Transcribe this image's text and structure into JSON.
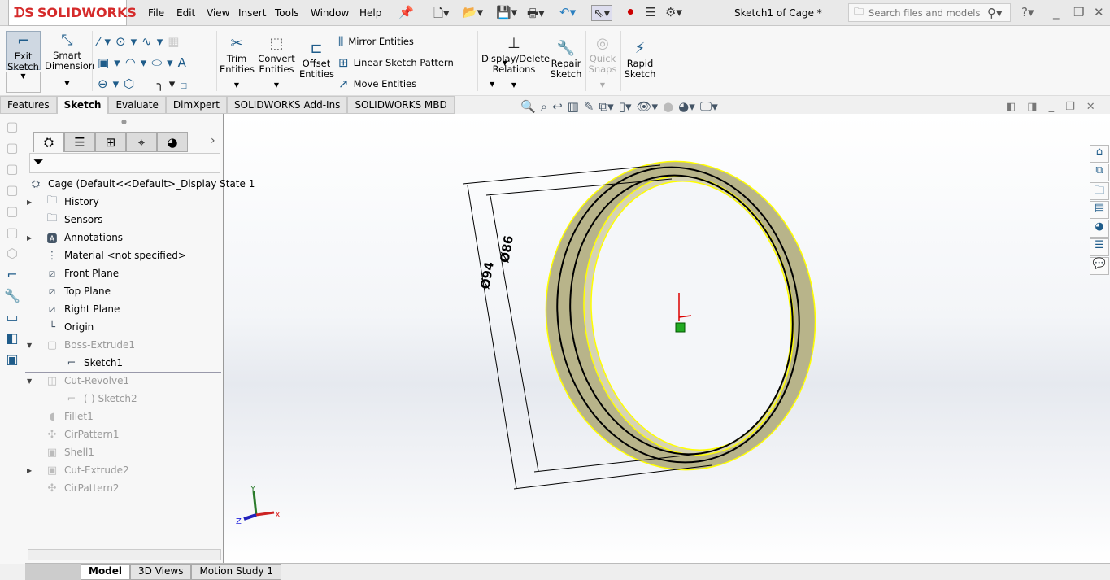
{
  "app": {
    "logo": "SOLIDWORKS",
    "document_title": "Sketch1 of Cage *"
  },
  "menu": [
    "File",
    "Edit",
    "View",
    "Insert",
    "Tools",
    "Window",
    "Help"
  ],
  "search": {
    "placeholder": "Search files and models"
  },
  "ribbon": {
    "exit_sketch": "Exit Sketch",
    "smart_dimension": "Smart Dimension",
    "trim": "Trim Entities",
    "convert": "Convert Entities",
    "offset": "Offset Entities",
    "mirror": "Mirror Entities",
    "linear_pattern": "Linear Sketch Pattern",
    "move": "Move Entities",
    "relations": "Display/Delete Relations",
    "repair": "Repair Sketch",
    "quick_snaps": "Quick Snaps",
    "rapid": "Rapid Sketch"
  },
  "tabs": [
    "Features",
    "Sketch",
    "Evaluate",
    "DimXpert",
    "SOLIDWORKS Add-Ins",
    "SOLIDWORKS MBD"
  ],
  "active_tab": "Sketch",
  "tree": {
    "root": "Cage  (Default<<Default>_Display State 1",
    "items": [
      {
        "label": "History",
        "icon": "history-folder-icon"
      },
      {
        "label": "Sensors",
        "icon": "sensors-folder-icon"
      },
      {
        "label": "Annotations",
        "icon": "annotations-folder-icon"
      },
      {
        "label": "Material <not specified>",
        "icon": "material-icon"
      },
      {
        "label": "Front Plane",
        "icon": "plane-icon"
      },
      {
        "label": "Top Plane",
        "icon": "plane-icon"
      },
      {
        "label": "Right Plane",
        "icon": "plane-icon"
      },
      {
        "label": "Origin",
        "icon": "origin-icon"
      },
      {
        "label": "Boss-Extrude1",
        "icon": "extrude-icon"
      },
      {
        "label": "Sketch1",
        "icon": "sketch-icon"
      },
      {
        "label": "Cut-Revolve1",
        "icon": "revolve-icon"
      },
      {
        "label": "(-) Sketch2",
        "icon": "sketch-icon"
      },
      {
        "label": "Fillet1",
        "icon": "fillet-icon"
      },
      {
        "label": "CirPattern1",
        "icon": "pattern-icon"
      },
      {
        "label": "Shell1",
        "icon": "shell-icon"
      },
      {
        "label": "Cut-Extrude2",
        "icon": "cut-extrude-icon"
      },
      {
        "label": "CirPattern2",
        "icon": "pattern-icon"
      }
    ]
  },
  "dimensions": {
    "outer": "Ø94",
    "inner": "Ø86"
  },
  "triad": {
    "x": "X",
    "y": "Y",
    "z": "Z"
  },
  "bottom_tabs": [
    "Model",
    "3D Views",
    "Motion Study 1"
  ],
  "colors": {
    "accent": "#1f5c8a",
    "brand": "#d52b2b",
    "part_face": "#b8b48a",
    "selection": "#ffff00"
  }
}
